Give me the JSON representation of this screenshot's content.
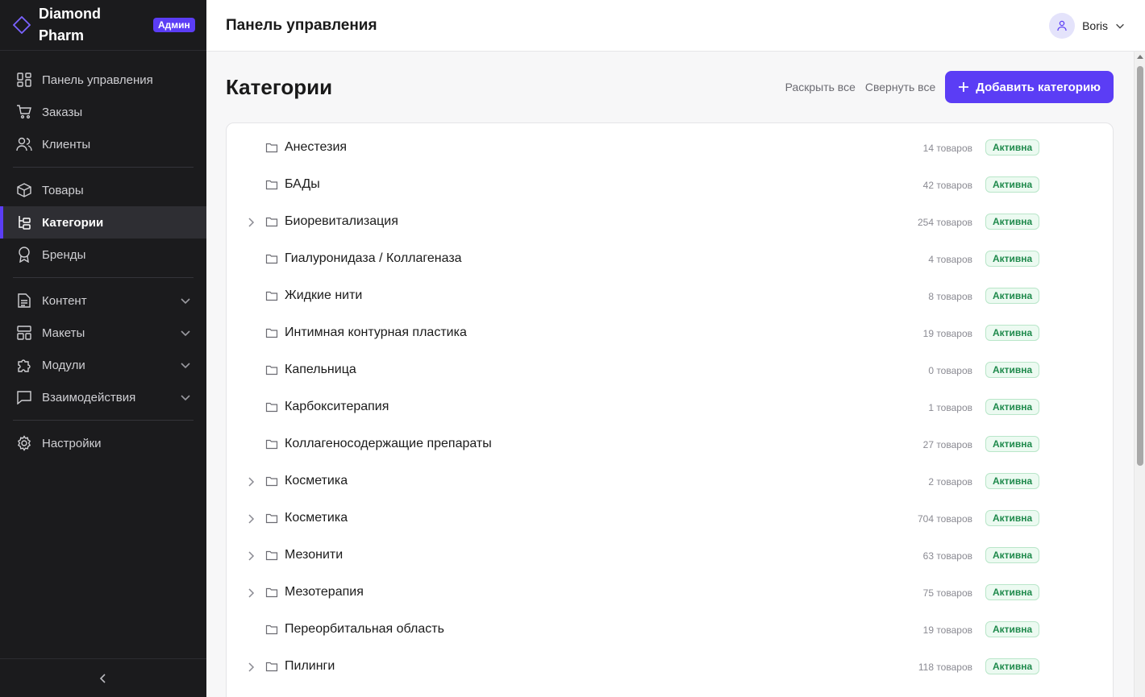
{
  "sidebar": {
    "brand": "Diamond Pharm",
    "badge": "Админ",
    "items": [
      {
        "label": "Панель управления",
        "icon": "dashboard-icon"
      },
      {
        "label": "Заказы",
        "icon": "cart-icon"
      },
      {
        "label": "Клиенты",
        "icon": "users-icon"
      },
      {
        "label": "Товары",
        "icon": "box-icon"
      },
      {
        "label": "Категории",
        "icon": "categories-icon",
        "active": true
      },
      {
        "label": "Бренды",
        "icon": "award-icon"
      },
      {
        "label": "Контент",
        "icon": "document-icon",
        "expandable": true
      },
      {
        "label": "Макеты",
        "icon": "layout-icon",
        "expandable": true
      },
      {
        "label": "Модули",
        "icon": "puzzle-icon",
        "expandable": true
      },
      {
        "label": "Взаимодействия",
        "icon": "message-icon",
        "expandable": true
      },
      {
        "label": "Настройки",
        "icon": "gear-icon"
      }
    ]
  },
  "topbar": {
    "title": "Панель управления",
    "user": "Boris"
  },
  "page": {
    "title": "Категории",
    "expand_all": "Раскрыть все",
    "collapse_all": "Свернуть все",
    "add_button": "Добавить категорию"
  },
  "categories": [
    {
      "name": "Анестезия",
      "count": "14 товаров",
      "status": "Активна",
      "has_children": false
    },
    {
      "name": "БАДы",
      "count": "42 товаров",
      "status": "Активна",
      "has_children": false
    },
    {
      "name": "Биоревитализация",
      "count": "254 товаров",
      "status": "Активна",
      "has_children": true
    },
    {
      "name": "Гиалуронидаза / Коллагеназа",
      "count": "4 товаров",
      "status": "Активна",
      "has_children": false
    },
    {
      "name": "Жидкие нити",
      "count": "8 товаров",
      "status": "Активна",
      "has_children": false
    },
    {
      "name": "Интимная контурная пластика",
      "count": "19 товаров",
      "status": "Активна",
      "has_children": false
    },
    {
      "name": "Капельница",
      "count": "0 товаров",
      "status": "Активна",
      "has_children": false
    },
    {
      "name": "Карбокситерапия",
      "count": "1 товаров",
      "status": "Активна",
      "has_children": false
    },
    {
      "name": "Коллагеносодержащие препараты",
      "count": "27 товаров",
      "status": "Активна",
      "has_children": false
    },
    {
      "name": "Косметика",
      "count": "2 товаров",
      "status": "Активна",
      "has_children": true
    },
    {
      "name": "Косметика",
      "count": "704 товаров",
      "status": "Активна",
      "has_children": true
    },
    {
      "name": "Мезонити",
      "count": "63 товаров",
      "status": "Активна",
      "has_children": true
    },
    {
      "name": "Мезотерапия",
      "count": "75 товаров",
      "status": "Активна",
      "has_children": true
    },
    {
      "name": "Переорбитальная область",
      "count": "19 товаров",
      "status": "Активна",
      "has_children": false
    },
    {
      "name": "Пилинги",
      "count": "118 товаров",
      "status": "Активна",
      "has_children": true
    }
  ],
  "colors": {
    "accent": "#5b3df5",
    "sidebar_bg": "#1b1b1d",
    "status_green": "#1f8a4c"
  }
}
